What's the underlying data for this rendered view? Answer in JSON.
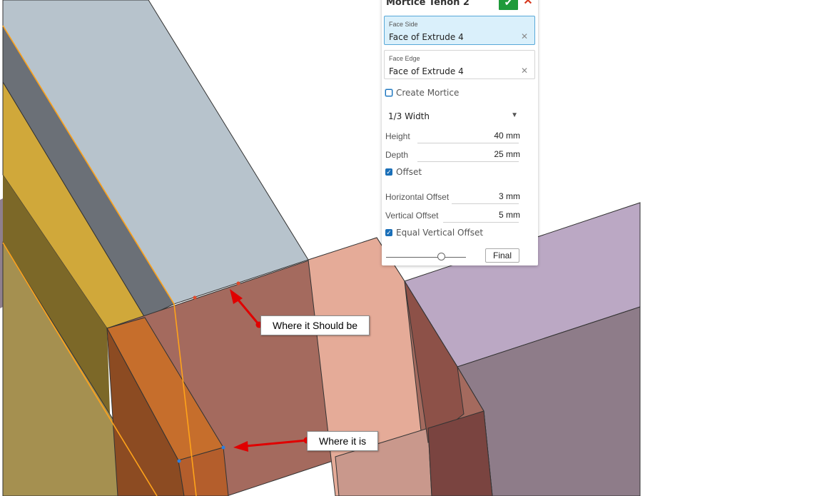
{
  "panel": {
    "title": "Mortice Tenon 2",
    "face_side": {
      "label": "Face Side",
      "value": "Face of Extrude 4"
    },
    "face_edge": {
      "label": "Face Edge",
      "value": "Face of Extrude 4"
    },
    "create_mortice": {
      "label": "Create Mortice",
      "checked": false
    },
    "width_select": {
      "value": "1/3 Width"
    },
    "height": {
      "label": "Height",
      "value": "40 mm"
    },
    "depth": {
      "label": "Depth",
      "value": "25 mm"
    },
    "offset": {
      "label": "Offset",
      "checked": true
    },
    "horizontal_offset": {
      "label": "Horizontal Offset",
      "value": "3 mm"
    },
    "vertical_offset": {
      "label": "Vertical Offset",
      "value": "5 mm"
    },
    "equal_vertical_offset": {
      "label": "Equal Vertical Offset",
      "checked": true
    },
    "final_button": "Final",
    "ok_icon": "check-icon",
    "cancel_icon": "close-icon"
  },
  "annotations": {
    "should_be": "Where it Should be",
    "is": "Where it is"
  },
  "colors": {
    "accent_green": "#1f9a3a",
    "cancel_red": "#d8391f",
    "selected_field": "#daf0fb",
    "annotation_arrow": "#e00000"
  }
}
